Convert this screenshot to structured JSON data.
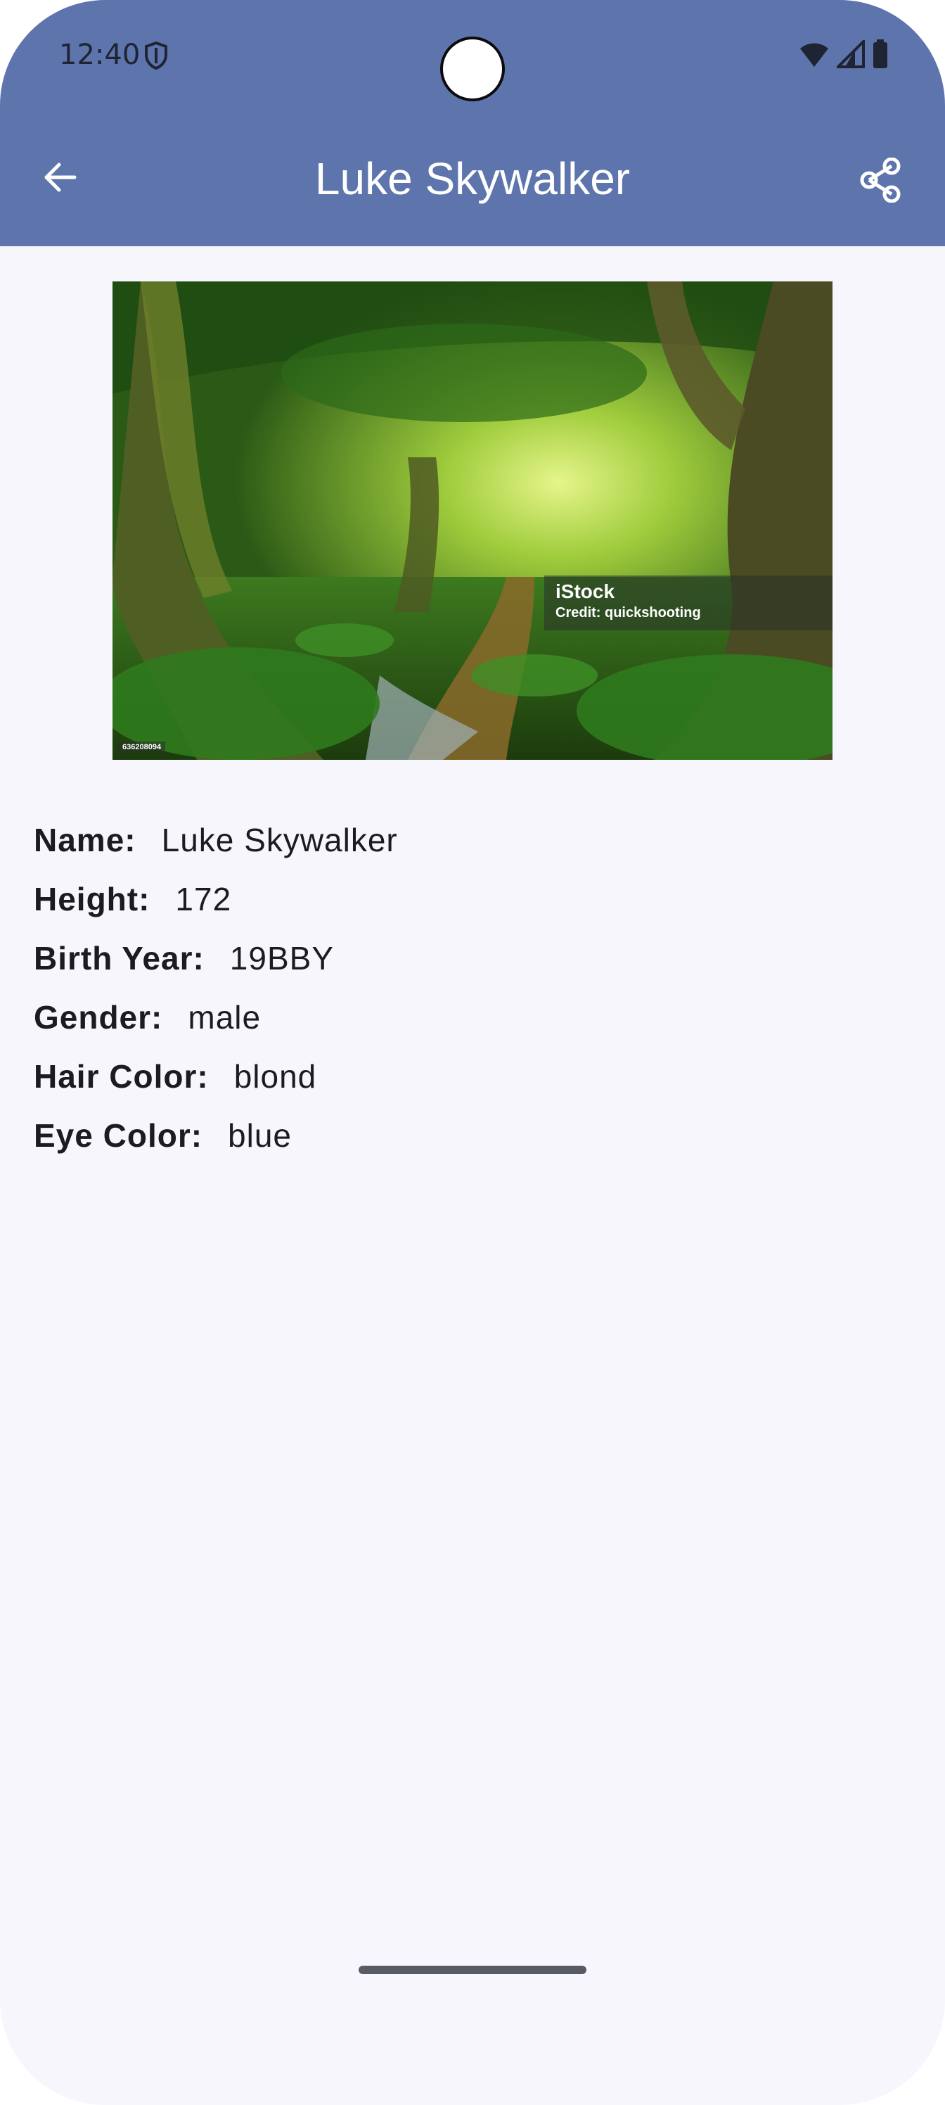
{
  "status_bar": {
    "time": "12:40",
    "icons": [
      "shield-icon",
      "wifi-icon",
      "cellular-signal-icon",
      "battery-icon"
    ]
  },
  "app_bar": {
    "title": "Luke Skywalker",
    "back_icon": "arrow-back-icon",
    "share_icon": "share-icon",
    "background": "#5e74ad"
  },
  "image": {
    "description": "Jungle forest with path and stream",
    "watermark_brand": "iStock",
    "watermark_credit": "Credit: quickshooting",
    "image_id": "636208094"
  },
  "details": [
    {
      "label": "Name:",
      "value": "Luke Skywalker"
    },
    {
      "label": "Height:",
      "value": "172"
    },
    {
      "label": "Birth Year:",
      "value": "19BBY"
    },
    {
      "label": "Gender:",
      "value": "male"
    },
    {
      "label": "Hair Color:",
      "value": "blond"
    },
    {
      "label": "Eye Color:",
      "value": "blue"
    }
  ]
}
